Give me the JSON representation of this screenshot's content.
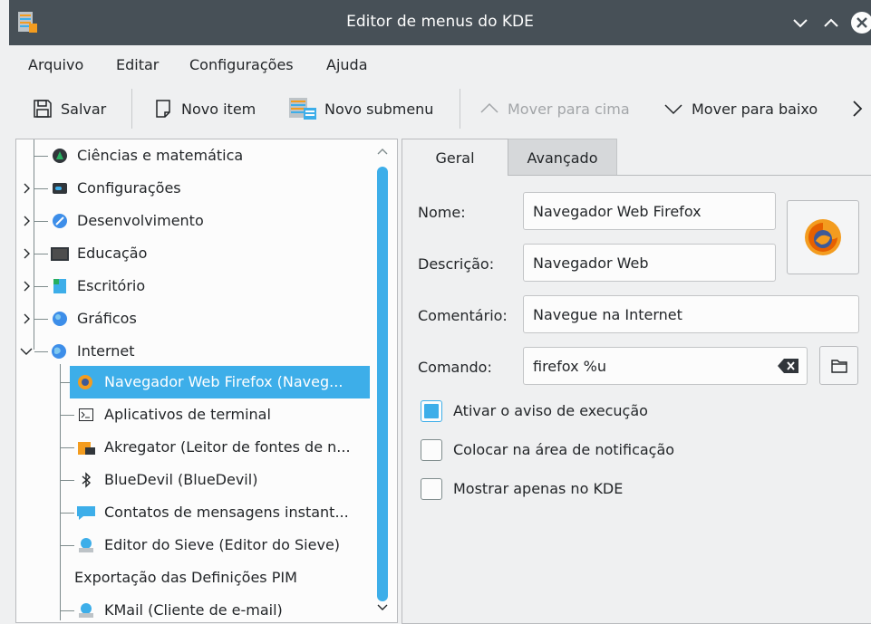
{
  "window": {
    "title": "Editor de menus do KDE"
  },
  "menubar": [
    "Arquivo",
    "Editar",
    "Configurações",
    "Ajuda"
  ],
  "toolbar": {
    "save": "Salvar",
    "new_item": "Novo item",
    "new_submenu": "Novo submenu",
    "move_up": "Mover para cima",
    "move_down": "Mover para baixo"
  },
  "tree": {
    "items": [
      {
        "label": "Ciências e matemática",
        "icon": "science-icon"
      },
      {
        "label": "Configurações",
        "icon": "settings-icon"
      },
      {
        "label": "Desenvolvimento",
        "icon": "development-icon"
      },
      {
        "label": "Educação",
        "icon": "education-icon"
      },
      {
        "label": "Escritório",
        "icon": "office-icon"
      },
      {
        "label": "Gráficos",
        "icon": "graphics-icon"
      },
      {
        "label": "Internet",
        "icon": "internet-icon"
      },
      {
        "label": "Navegador Web Firefox (Naveg...",
        "icon": "firefox-icon",
        "selected": true
      },
      {
        "label": "Aplicativos de terminal",
        "icon": "terminal-icon"
      },
      {
        "label": "Akregator (Leitor de fontes de n...",
        "icon": "akregator-icon"
      },
      {
        "label": "BlueDevil (BlueDevil)",
        "icon": "bluetooth-icon"
      },
      {
        "label": "Contatos de mensagens instant...",
        "icon": "chat-icon"
      },
      {
        "label": "Editor do Sieve (Editor do Sieve)",
        "icon": "sieve-icon"
      },
      {
        "label": "Exportação das Definições PIM",
        "icon": ""
      },
      {
        "label": "KMail (Cliente de e-mail)",
        "icon": "kmail-icon"
      }
    ]
  },
  "tabs": {
    "general": "Geral",
    "advanced": "Avançado"
  },
  "form": {
    "name_label": "Nome:",
    "name_value": "Navegador Web Firefox",
    "description_label": "Descrição:",
    "description_value": "Navegador Web",
    "comment_label": "Comentário:",
    "comment_value": "Navegue na Internet",
    "command_label": "Comando:",
    "command_value": "firefox %u",
    "launch_feedback": "Ativar o aviso de execução",
    "launch_feedback_checked": true,
    "tray": "Colocar na área de notificação",
    "tray_checked": false,
    "kde_only": "Mostrar apenas no KDE",
    "kde_only_checked": false
  },
  "colors": {
    "accent": "#3daee9",
    "titlebar": "#475057",
    "window_bg": "#eff0f1"
  }
}
